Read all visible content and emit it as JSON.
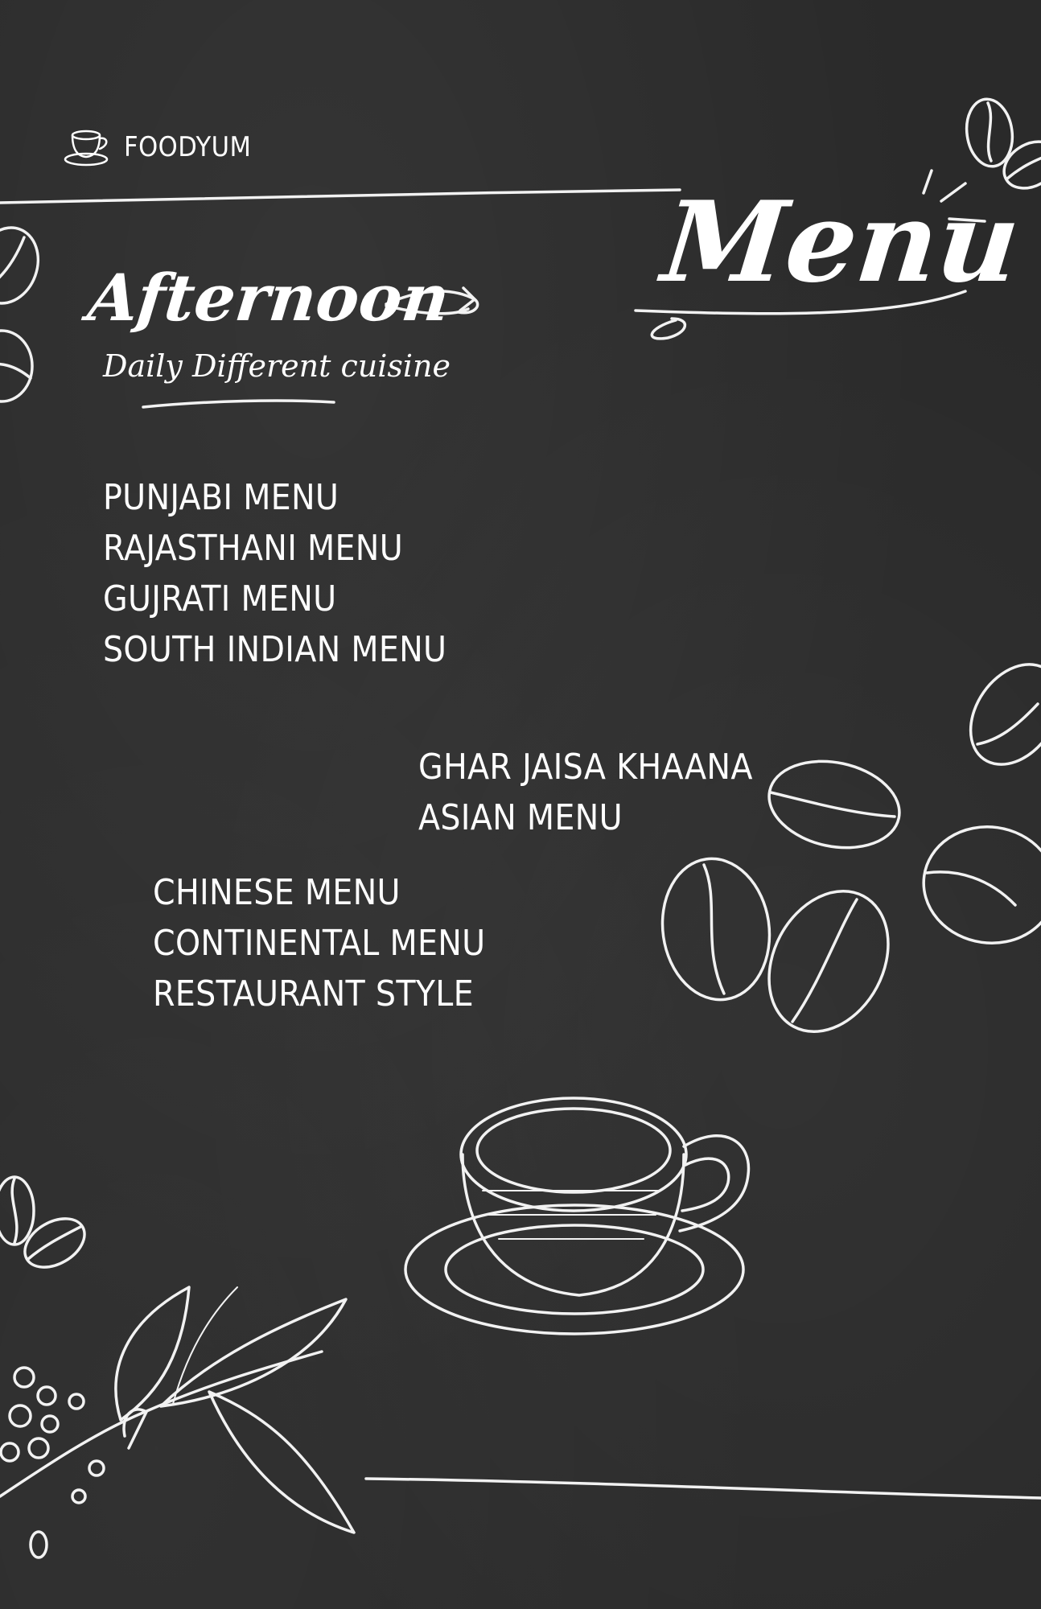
{
  "brand": {
    "name": "FOODYUM",
    "icon": "coffee-cup-icon"
  },
  "header": {
    "title": "Menu"
  },
  "section": {
    "title": "Afternoon",
    "subtitle": "Daily Different cuisine"
  },
  "menu_groups": [
    {
      "items": [
        "PUNJABI MENU",
        "RAJASTHANI MENU",
        "GUJRATI MENU",
        "SOUTH INDIAN MENU"
      ]
    },
    {
      "items": [
        "GHAR JAISA KHAANA",
        "ASIAN MENU"
      ]
    },
    {
      "items": [
        "CHINESE MENU",
        "CONTINENTAL MENU",
        "RESTAURANT STYLE"
      ]
    }
  ],
  "colors": {
    "background": "#2a2a2a",
    "ink": "#ffffff"
  },
  "decorations": [
    "coffee-bean-icon",
    "coffee-cup-icon",
    "coffee-branch-icon",
    "arrow-icon"
  ]
}
